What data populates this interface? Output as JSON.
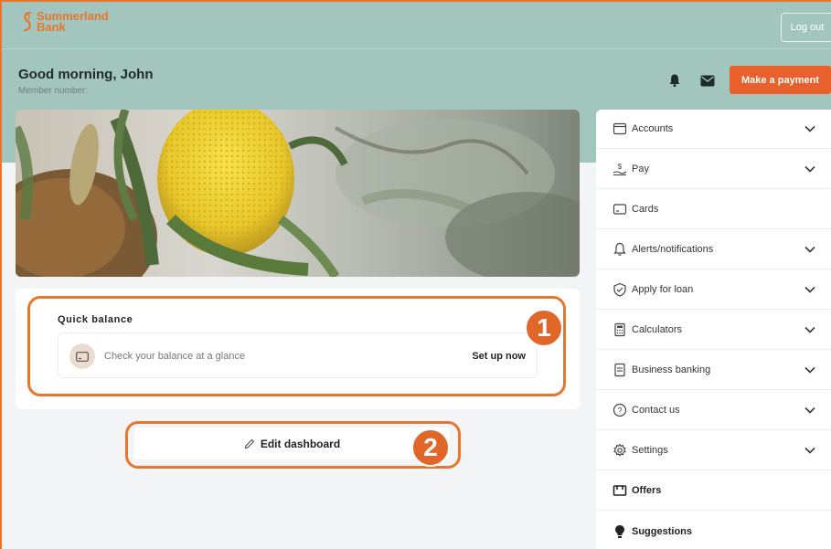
{
  "header": {
    "logo_line1": "Summerland",
    "logo_line2": "Bank",
    "logout_label": "Log out",
    "greeting": "Good morning, John",
    "member_label": "Member number:",
    "make_payment_label": "Make a payment"
  },
  "quick_balance": {
    "title": "Quick balance",
    "description": "Check your balance at a glance",
    "setup_label": "Set up now"
  },
  "edit_dashboard_label": "Edit dashboard",
  "callouts": [
    {
      "number": "1"
    },
    {
      "number": "2"
    }
  ],
  "sidebar": {
    "items": [
      {
        "label": "Accounts",
        "icon": "accounts-icon",
        "expandable": true
      },
      {
        "label": "Pay",
        "icon": "pay-icon",
        "expandable": true
      },
      {
        "label": "Cards",
        "icon": "cards-icon",
        "expandable": false
      },
      {
        "label": "Alerts/notifications",
        "icon": "bell-icon",
        "expandable": true
      },
      {
        "label": "Apply for loan",
        "icon": "shield-check-icon",
        "expandable": true
      },
      {
        "label": "Calculators",
        "icon": "calculator-icon",
        "expandable": true
      },
      {
        "label": "Business banking",
        "icon": "business-icon",
        "expandable": true
      },
      {
        "label": "Contact us",
        "icon": "help-icon",
        "expandable": true
      },
      {
        "label": "Settings",
        "icon": "gear-icon",
        "expandable": true
      },
      {
        "label": "Offers",
        "icon": "offers-icon",
        "expandable": false
      },
      {
        "label": "Suggestions",
        "icon": "lightbulb-icon",
        "expandable": false
      }
    ]
  },
  "colors": {
    "brand": "#e8762c",
    "header_bg": "#a2c6bd",
    "button": "#e8612c",
    "page_bg": "#f3f4f6"
  }
}
